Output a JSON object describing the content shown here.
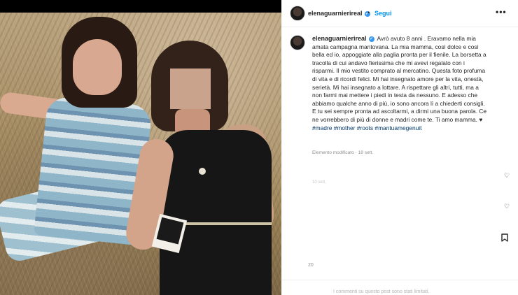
{
  "post": {
    "username": "elenaguarnierireal",
    "follow_label": "Segui",
    "separator": "•",
    "more_label": "•••",
    "caption": "Avrò avuto 8 anni . Eravamo nella mia amata campagna mantovana. La mia mamma, così dolce e così bella ed io, appoggiate alla paglia pronta per il fienile. La borsetta a tracolla di cui andavo fierissima che mi avevi regalato con i risparmi. Il mio vestito comprato al mercatino. Questa foto profuma di vita e di ricordi felici. Mi hai insegnato amore per la vita, onestà, serietà. Mi hai insegnato a lottare. A rispettare gli altri, tutti, ma a non farmi mai mettere i piedi in testa da nessuno. E adesso che abbiamo qualche anno di più, io sono ancora lì a chiederti consigli. E tu sei sempre pronta ad ascoltarmi, a dirmi una buona parola. Ce ne vorrebbero di più di donne e madri come te. Ti amo mamma. ♥",
    "hashtags": [
      "#madre",
      "#mother",
      "#roots",
      "#mantuamegenuit"
    ],
    "edited_label": "Elemento modificato · 18 sett.",
    "ghost_text": "10 sett.",
    "likes_count": "20",
    "comments_notice": "I commenti su questo post sono stati limitati."
  },
  "colors": {
    "link": "#0095f6",
    "hashtag": "#00376b",
    "verified": "#3897f0"
  },
  "icons": {
    "verified": "verified-badge-icon",
    "heart": "heart-outline-icon",
    "bookmark": "bookmark-icon"
  }
}
